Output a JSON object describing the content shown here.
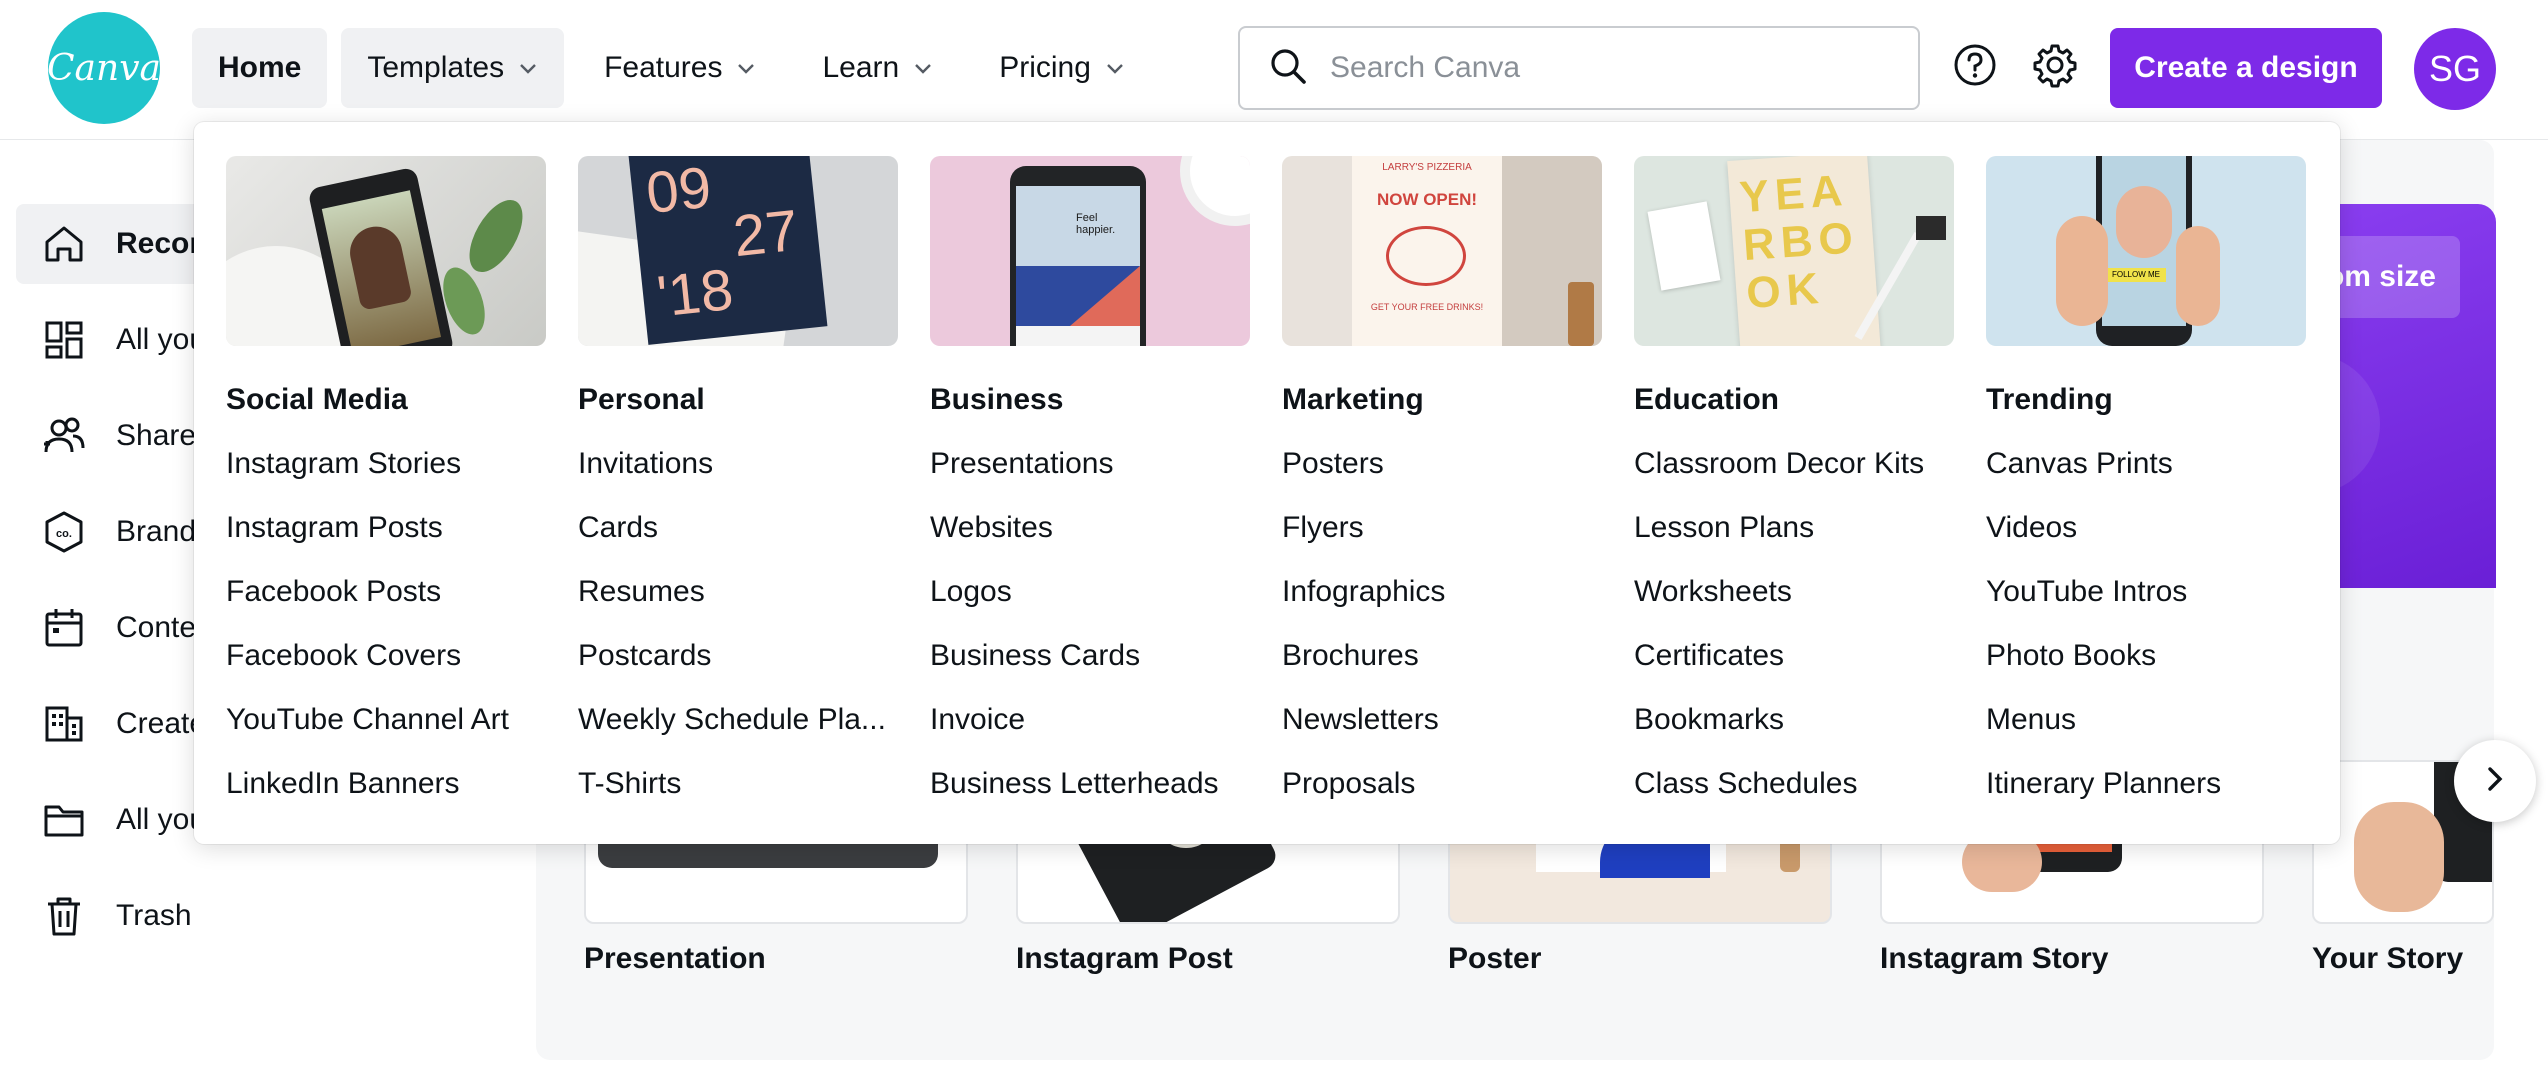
{
  "app": {
    "logo_text": "Canva",
    "brand_color": "#7d2ae8",
    "logo_color": "#20c4cb"
  },
  "nav": {
    "home": "Home",
    "templates": "Templates",
    "features": "Features",
    "learn": "Learn",
    "pricing": "Pricing"
  },
  "search": {
    "placeholder": "Search Canva"
  },
  "header": {
    "create_label": "Create a design",
    "avatar_initials": "SG"
  },
  "sidebar": {
    "items": [
      {
        "label": "Recon",
        "icon": "home-icon"
      },
      {
        "label": "All you",
        "icon": "grid-icon"
      },
      {
        "label": "Shared",
        "icon": "people-icon"
      },
      {
        "label": "Brand",
        "icon": "brand-icon"
      },
      {
        "label": "Conten",
        "icon": "calendar-icon"
      },
      {
        "label": "Create",
        "icon": "building-icon"
      },
      {
        "label": "All you",
        "icon": "folder-icon"
      },
      {
        "label": "Trash",
        "icon": "trash-icon"
      }
    ]
  },
  "hero": {
    "button_label": "Custom size"
  },
  "cards": [
    "Presentation",
    "Instagram Post",
    "Poster",
    "Instagram Story",
    "Your Story"
  ],
  "dropdown": {
    "columns": [
      {
        "title": "Social Media",
        "links": [
          "Instagram Stories",
          "Instagram Posts",
          "Facebook Posts",
          "Facebook Covers",
          "YouTube Channel Art",
          "LinkedIn Banners"
        ]
      },
      {
        "title": "Personal",
        "links": [
          "Invitations",
          "Cards",
          "Resumes",
          "Postcards",
          "Weekly Schedule Pla...",
          "T-Shirts"
        ]
      },
      {
        "title": "Business",
        "links": [
          "Presentations",
          "Websites",
          "Logos",
          "Business Cards",
          "Invoice",
          "Business Letterheads"
        ]
      },
      {
        "title": "Marketing",
        "links": [
          "Posters",
          "Flyers",
          "Infographics",
          "Brochures",
          "Newsletters",
          "Proposals"
        ]
      },
      {
        "title": "Education",
        "links": [
          "Classroom Decor Kits",
          "Lesson Plans",
          "Worksheets",
          "Certificates",
          "Bookmarks",
          "Class Schedules"
        ]
      },
      {
        "title": "Trending",
        "links": [
          "Canvas Prints",
          "Videos",
          "YouTube Intros",
          "Photo Books",
          "Menus",
          "Itinerary Planners"
        ]
      }
    ],
    "thumbs": {
      "social": {
        "date_top": "",
        "headline": ""
      },
      "personal": {
        "line1": "09",
        "line2": "27",
        "line3": "'18"
      },
      "business": {
        "phone_text": "Feel happier."
      },
      "marketing": {
        "poster_top": "LARRY'S PIZZERIA",
        "poster_main": "NOW OPEN!",
        "poster_sub": "GET YOUR FREE DRINKS!"
      },
      "education": {
        "yearbook": "YEARBOOK"
      },
      "trending": {
        "story_tag": "FOLLOW ME"
      }
    }
  }
}
